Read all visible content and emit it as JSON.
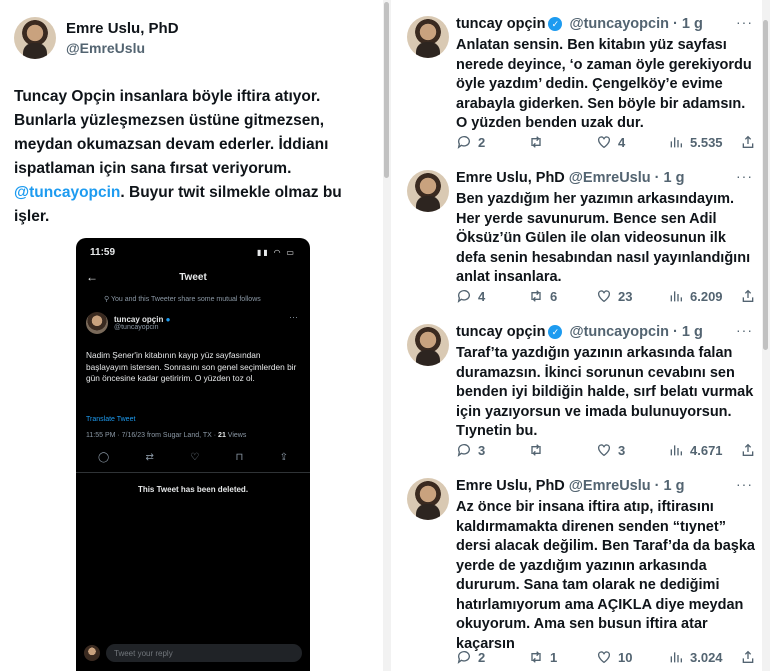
{
  "main_tweet": {
    "author_name": "Emre Uslu, PhD",
    "author_handle": "@EmreUslu",
    "text_part1": "Tuncay Opçin insanlara böyle iftira atıyor. Bunlarla yüzleşmezsen üstüne gitmezsen, meydan okumazsan devam ederler. İddianı ispatlaman için sana fırsat veriyorum.",
    "mention": "@tuncayopcin",
    "text_part2": ". Buyur twit silmekle olmaz bu işler."
  },
  "embedded_screenshot": {
    "time": "11:59",
    "title": "Tweet",
    "mutual_note": "You and this Tweeter share some mutual follows",
    "author_name": "tuncay opçin",
    "author_handle": "@tuncayopcin",
    "text": "Nadim Şener'in kitabının kayıp yüz sayfasından başlayayım istersen. Sonrasını son genel seçimlerden bir gün öncesine kadar getiririm. O yüzden toz ol.",
    "translate_label": "Translate Tweet",
    "meta_prefix": "11:55 PM · 7/16/23 from Sugar Land, TX · ",
    "views_count": "21",
    "views_label": " Views",
    "deleted_notice": "This Tweet has been deleted.",
    "reply_placeholder": "Tweet your reply"
  },
  "replies": [
    {
      "name": "tuncay opçin",
      "verified": true,
      "handle_time": "@tuncayopcin · 1 g",
      "text": "Anlatan sensin. Ben kitabın yüz sayfası nerede deyince, ‘o zaman öyle gerekiyordu öyle yazdım’ dedin. Çengelköy’e evime arabayla giderken. Sen böyle bir adamsın. O yüzden benden uzak dur.",
      "replies": "2",
      "retweets": "",
      "likes": "4",
      "views": "5.535"
    },
    {
      "name": "Emre Uslu, PhD",
      "verified": false,
      "handle_time": "@EmreUslu · 1 g",
      "text": "Ben yazdığım her yazımın arkasındayım. Her yerde savunurum. Bence sen Adil Öksüz’ün Gülen ile olan videosunun ilk defa senin hesabından nasıl yayınlandığını anlat insanlara.",
      "replies": "4",
      "retweets": "6",
      "likes": "23",
      "views": "6.209"
    },
    {
      "name": "tuncay opçin",
      "verified": true,
      "handle_time": "@tuncayopcin · 1 g",
      "text": "Taraf’ta yazdığın yazının arkasında falan duramazsın. İkinci sorunun cevabını sen benden iyi bildiğin halde, sırf belatı vurmak için yazıyorsun ve imada bulunuyorsun. Tıynetin bu.",
      "replies": "3",
      "retweets": "",
      "likes": "3",
      "views": "4.671"
    },
    {
      "name": "Emre Uslu, PhD",
      "verified": false,
      "handle_time": "@EmreUslu · 1 g",
      "text": "Az önce bir insana iftira atıp, iftirasını kaldırmamakta direnen senden “tıynet” dersi alacak değilim. Ben Taraf’da da başka yerde de yazdığım yazının arkasında dururum. Sana tam olarak ne dediğimi hatırlamıyorum ama AÇIKLA diye meydan okuyorum. Ama sen busun iftira atar kaçarsın",
      "replies": "2",
      "retweets": "1",
      "likes": "10",
      "views": "3.024"
    }
  ],
  "icons": [
    "reply-icon",
    "retweet-icon",
    "like-icon",
    "views-icon",
    "share-icon",
    "verified-icon",
    "more-icon",
    "back-icon",
    "bookmark-icon"
  ],
  "colors": {
    "accent": "#1d9bf0",
    "text": "#0f1419",
    "muted": "#536471",
    "dark_bg": "#000000"
  }
}
